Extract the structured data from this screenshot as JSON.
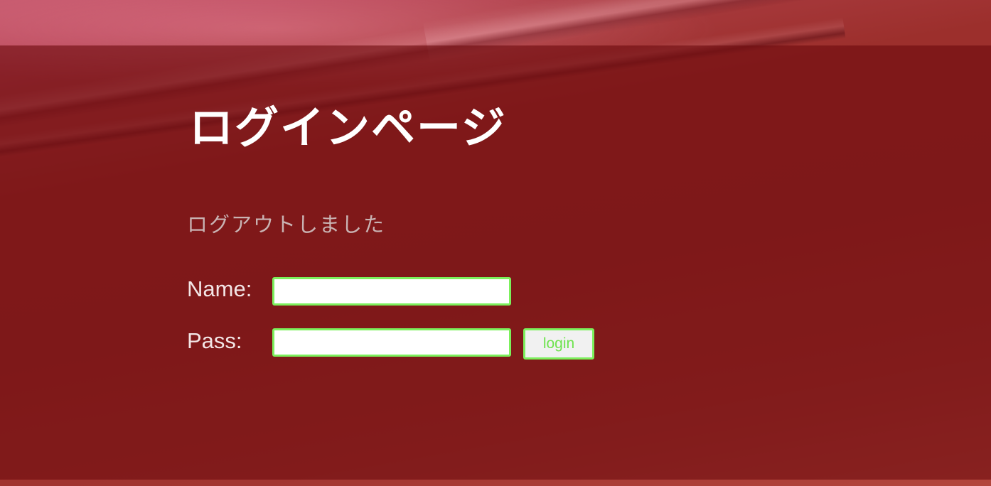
{
  "page": {
    "title": "ログインページ",
    "status_message": "ログアウトしました"
  },
  "form": {
    "name_label": "Name:",
    "name_value": "",
    "pass_label": "Pass:",
    "pass_value": "",
    "login_button": "login"
  },
  "colors": {
    "accent_border": "#7cf05c",
    "button_text": "#6ee34e",
    "panel_overlay": "rgba(110,12,14,0.62)"
  }
}
